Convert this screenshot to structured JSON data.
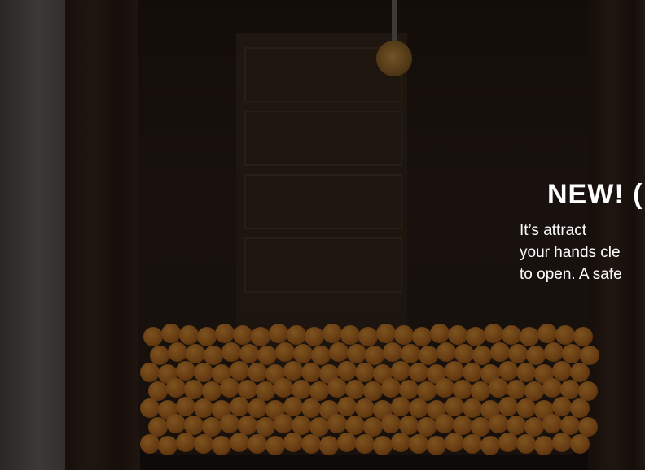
{
  "hero": {
    "headline": "NEW! (",
    "copy_lines": [
      "It’s attract",
      "your hands cle",
      "to open. A safe"
    ]
  },
  "photo": {
    "scene": "storefront window",
    "orange_color": "#c77622"
  }
}
